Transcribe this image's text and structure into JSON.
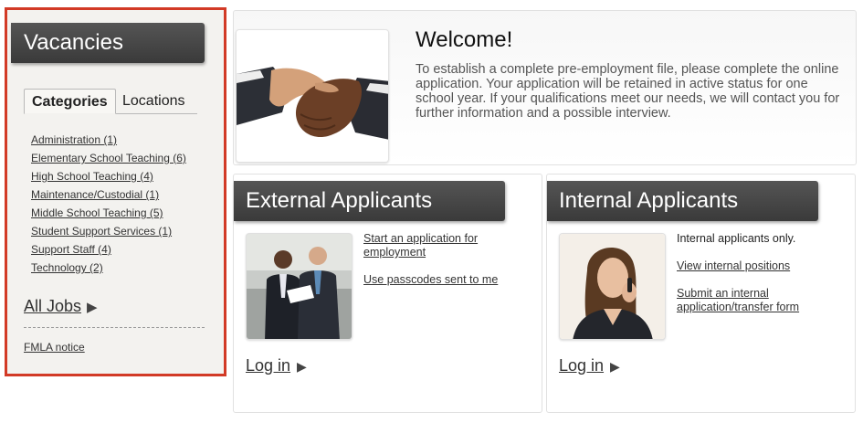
{
  "sidebar": {
    "title": "Vacancies",
    "tabs": [
      {
        "label": "Categories",
        "active": true
      },
      {
        "label": "Locations",
        "active": false
      }
    ],
    "categories": [
      "Administration (1)",
      "Elementary School Teaching (6)",
      "High School Teaching (4)",
      "Maintenance/Custodial (1)",
      "Middle School Teaching (5)",
      "Student Support Services (1)",
      "Support Staff (4)",
      "Technology (2)"
    ],
    "all_jobs_label": "All Jobs",
    "all_jobs_arrow": "▶",
    "fmla_label": "FMLA notice"
  },
  "welcome": {
    "title": "Welcome!",
    "text": "To establish a complete pre-employment file, please complete the online application. Your application will be retained in active status for one school year. If your qualifications meet our needs, we will contact you for further information and a possible interview."
  },
  "external": {
    "title": "External Applicants",
    "links": [
      "Start an application for employment",
      "Use passcodes sent to me"
    ],
    "login_label": "Log in",
    "login_arrow": "▶"
  },
  "internal": {
    "title": "Internal Applicants",
    "note": "Internal applicants only.",
    "links": [
      "View internal positions",
      "Submit an internal application/transfer form"
    ],
    "login_label": "Log in",
    "login_arrow": "▶"
  },
  "colors": {
    "sidebar_border": "#d23a26",
    "header_bg": "#444444",
    "sidebar_bg": "#f3f2ef"
  }
}
